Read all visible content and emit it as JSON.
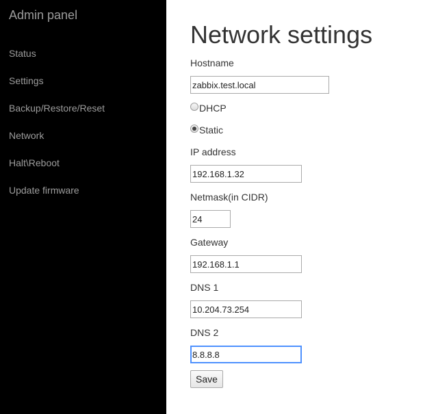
{
  "sidebar": {
    "brand": "Admin panel",
    "items": [
      {
        "label": "Status"
      },
      {
        "label": "Settings"
      },
      {
        "label": "Backup/Restore/Reset"
      },
      {
        "label": "Network"
      },
      {
        "label": "Halt\\Reboot"
      },
      {
        "label": "Update firmware"
      }
    ]
  },
  "main": {
    "title": "Network settings",
    "hostname": {
      "label": "Hostname",
      "value": "zabbix.test.local"
    },
    "mode": {
      "dhcp_label": "DHCP",
      "static_label": "Static",
      "selected": "Static"
    },
    "ip_address": {
      "label": "IP address",
      "value": "192.168.1.32"
    },
    "netmask": {
      "label": "Netmask(in CIDR)",
      "value": "24"
    },
    "gateway": {
      "label": "Gateway",
      "value": "192.168.1.1"
    },
    "dns1": {
      "label": "DNS 1",
      "value": "10.204.73.254"
    },
    "dns2": {
      "label": "DNS 2",
      "value": "8.8.8.8"
    },
    "save_label": "Save"
  }
}
